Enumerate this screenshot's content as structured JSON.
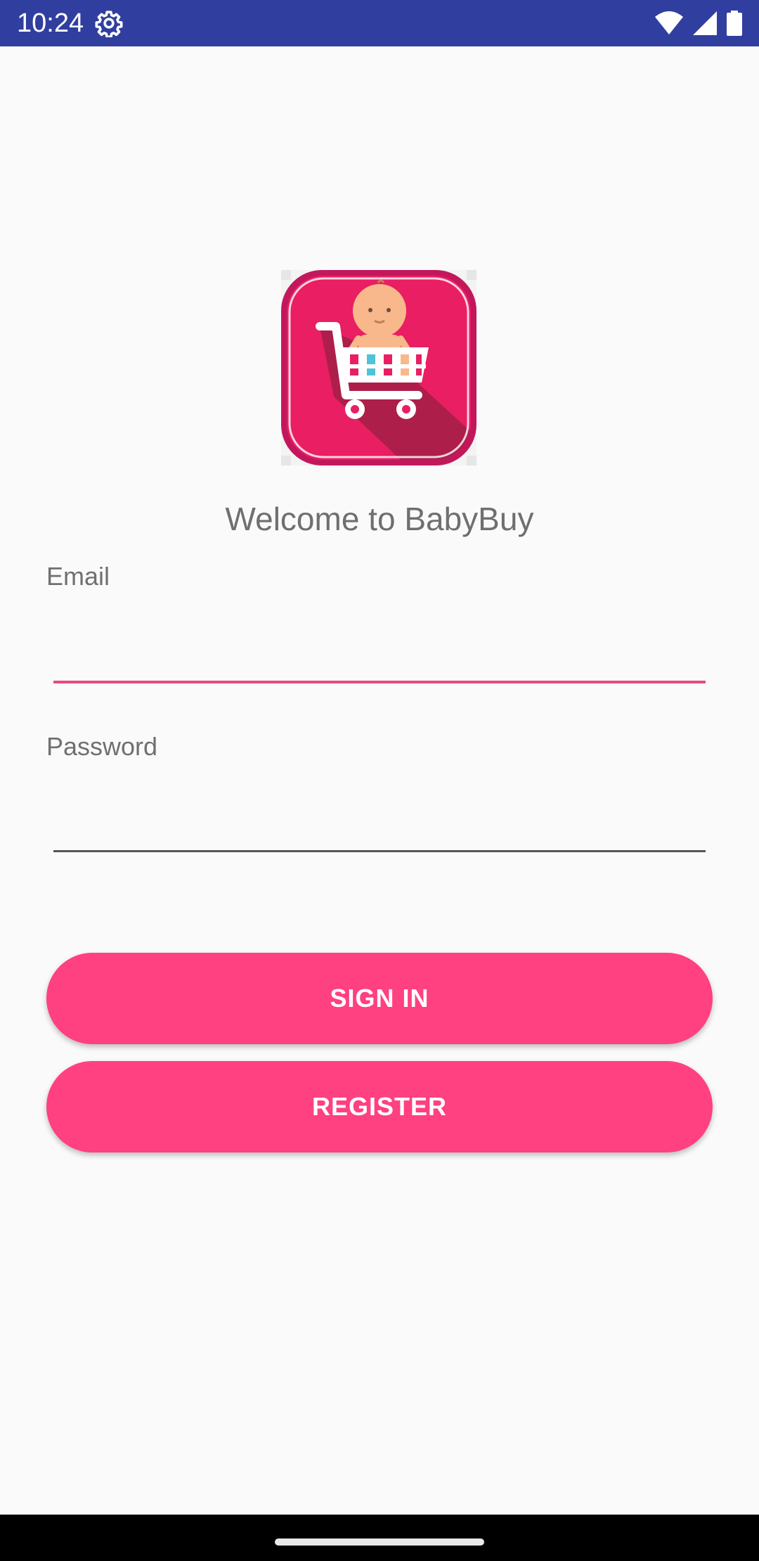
{
  "status_bar": {
    "time": "10:24",
    "background_color": "#303f9f",
    "icons": [
      "settings-gear-icon",
      "wifi-icon",
      "cellular-signal-icon",
      "battery-icon"
    ]
  },
  "logo": {
    "icon": "baby-in-shopping-cart-logo",
    "colors": {
      "primary": "#e91e63",
      "border": "#c2185b",
      "shadow": "#ad1f4a"
    }
  },
  "welcome_text": "Welcome to BabyBuy",
  "email": {
    "label": "Email",
    "value": "",
    "focused": true
  },
  "password": {
    "label": "Password",
    "value": ""
  },
  "buttons": {
    "sign_in": "SIGN IN",
    "register": "REGISTER"
  },
  "accent_color": "#ff4081",
  "navigation": {
    "handle": "home-gesture-handle"
  }
}
